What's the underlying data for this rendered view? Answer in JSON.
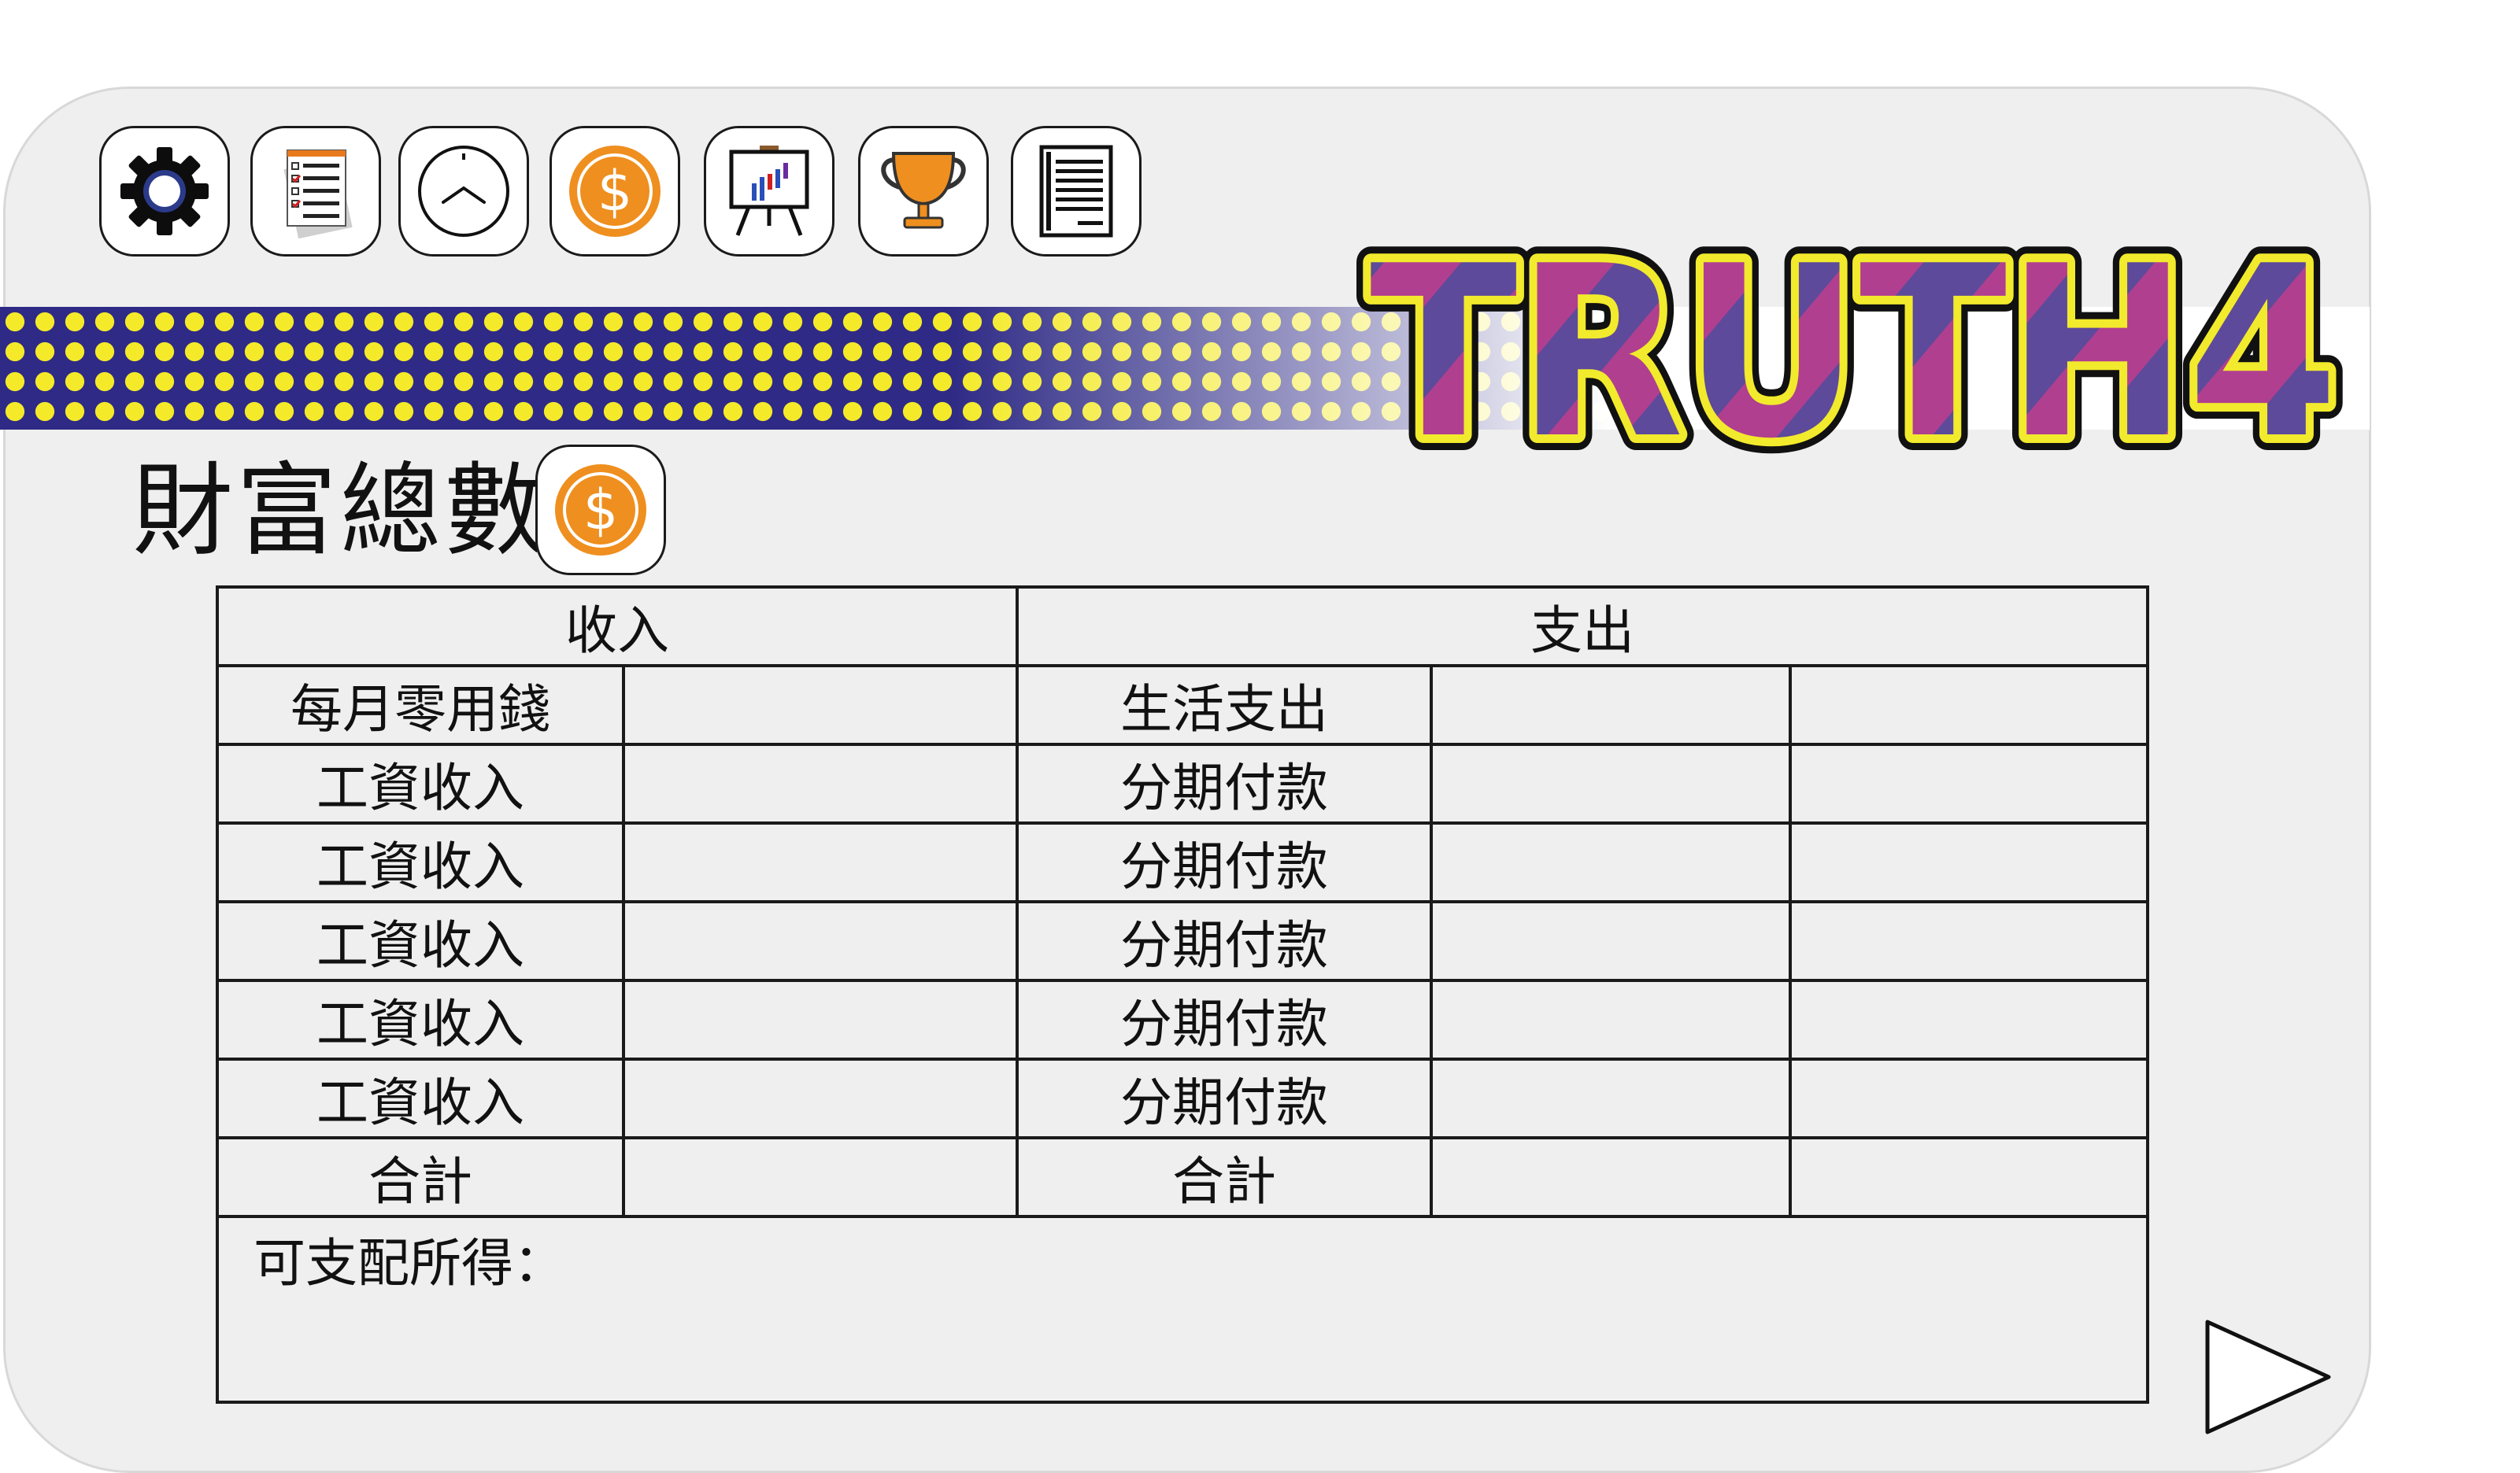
{
  "logo_text": "TRUTH4",
  "toolbar": {
    "icons": [
      {
        "name": "gear-icon"
      },
      {
        "name": "checklist-icon"
      },
      {
        "name": "clock-icon"
      },
      {
        "name": "coin-icon",
        "symbol": "$"
      },
      {
        "name": "presentation-chart-icon"
      },
      {
        "name": "trophy-icon"
      },
      {
        "name": "document-icon"
      }
    ]
  },
  "wealth": {
    "title": "財富總數",
    "coin_symbol": "$"
  },
  "table": {
    "income_header": "收入",
    "expense_header": "支出",
    "rows": [
      {
        "income_label": "每月零用錢",
        "income_value": "",
        "expense_label": "生活支出",
        "expense_value_1": "",
        "expense_value_2": ""
      },
      {
        "income_label": "工資收入",
        "income_value": "",
        "expense_label": "分期付款",
        "expense_value_1": "",
        "expense_value_2": ""
      },
      {
        "income_label": "工資收入",
        "income_value": "",
        "expense_label": "分期付款",
        "expense_value_1": "",
        "expense_value_2": ""
      },
      {
        "income_label": "工資收入",
        "income_value": "",
        "expense_label": "分期付款",
        "expense_value_1": "",
        "expense_value_2": ""
      },
      {
        "income_label": "工資收入",
        "income_value": "",
        "expense_label": "分期付款",
        "expense_value_1": "",
        "expense_value_2": ""
      },
      {
        "income_label": "工資收入",
        "income_value": "",
        "expense_label": "分期付款",
        "expense_value_1": "",
        "expense_value_2": ""
      }
    ],
    "total": {
      "income_label": "合計",
      "income_value": "",
      "expense_label": "合計",
      "expense_value_1": "",
      "expense_value_2": ""
    },
    "disposable_label": "可支配所得："
  },
  "colors": {
    "card_background": "#efefef",
    "banner_dots": "#f4ea2a",
    "banner_base": "#2e2a85",
    "logo_fill_pink": "#b03f8f",
    "logo_fill_purple": "#5d4a9a",
    "logo_outline": "#f2ea2c",
    "coin_orange": "#ef8f1f"
  },
  "next_button": {
    "icon": "play-triangle-icon"
  }
}
